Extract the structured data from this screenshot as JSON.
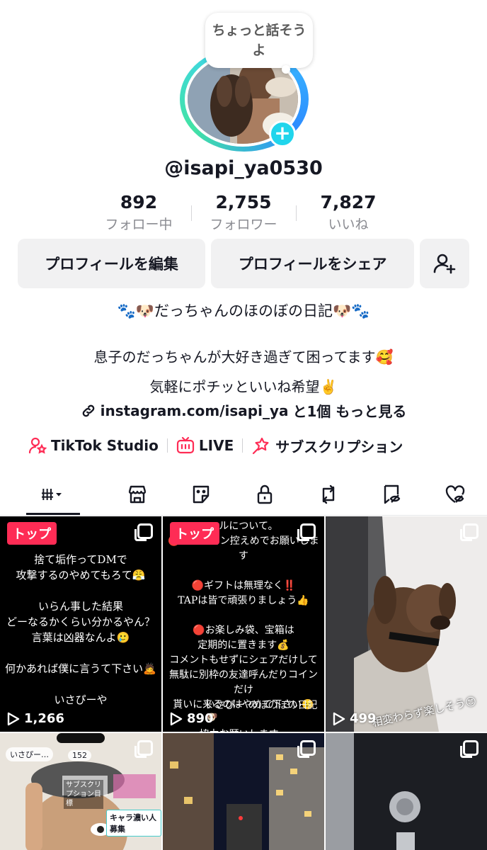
{
  "profile": {
    "bubble_text": "ちょっと話そうよ",
    "username": "@isapi_ya0530"
  },
  "stats": [
    {
      "value": "892",
      "label": "フォロー中"
    },
    {
      "value": "2,755",
      "label": "フォロワー"
    },
    {
      "value": "7,827",
      "label": "いいね"
    }
  ],
  "buttons": {
    "edit": "プロフィールを編集",
    "share": "プロフィールをシェア"
  },
  "bio": {
    "title": "🐾🐶だっちゃんのほのぼの日記🐶🐾",
    "line1": "息子のだっちゃんが大好き過ぎて困ってます🥰",
    "line2": "気軽にポチッといいね希望✌️",
    "link": "instagram.com/isapi_ya",
    "link_suffix": "と1個 もっと見る"
  },
  "tools": {
    "studio": "TikTok Studio",
    "live": "LIVE",
    "subscription": "サブスクリプション"
  },
  "tabs": [
    "videos-tab",
    "shop-tab",
    "sticker-tab",
    "private-tab",
    "repost-tab",
    "saved-tab",
    "liked-tab"
  ],
  "videos": [
    {
      "badge": "トップ",
      "text": "捨て垢作ってDMで\n攻撃するのやめてもろて😤\n\nいらん事した結果\nどーなるかくらい分かるやん？\n言葉は凶器なんよ🥲\n\n何かあれば僕に言うて下さい🙇\n\nいさぴーや",
      "views": "1,266"
    },
    {
      "badge": "トップ",
      "text": "ールについて。\n🔴メンション控えめでお願いします\n\n🔴ギフトは無理なく‼️\nTAPは皆で頑張りましょう👍\n\n🔴お楽しみ袋、宝箱は\n定期的に置きます💰\nコメントもせずにシェアだけして\n無駄に別枠の友達呼んだりコインだけ\n貰いに来るのはやめて下さい😑\n\n協力お願いします。",
      "caption": "いさぴー のほのぼの日記🐶",
      "views": "890"
    },
    {
      "badge": "",
      "caption": "相変わらず楽しそう😊",
      "views": "499"
    }
  ],
  "thumb_texts": {
    "live_name": "いさぴー…",
    "live_count": "152",
    "sub_goal": "サブスクリプション目標",
    "recruit": "キャラ濃い人募集"
  },
  "colors": {
    "accent": "#fe2c55",
    "teal": "#20d5ec"
  }
}
